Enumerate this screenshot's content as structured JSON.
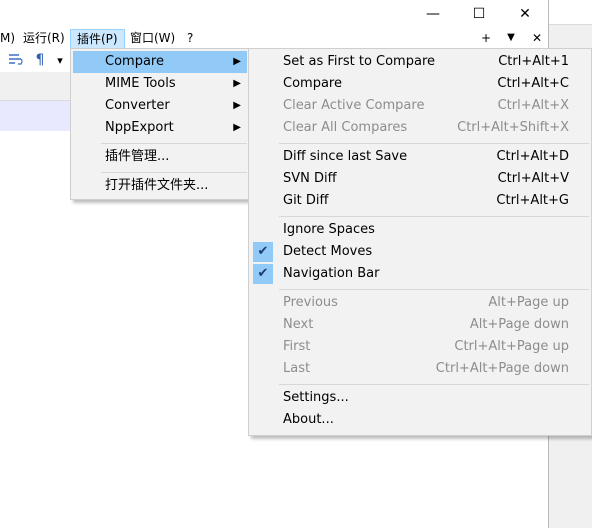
{
  "window": {
    "caption": {
      "minimize": "—",
      "maximize": "☐",
      "close": "✕"
    }
  },
  "menubar": {
    "items": [
      {
        "label": "M)"
      },
      {
        "label": "运行(R)"
      },
      {
        "label": "插件(P)"
      },
      {
        "label": "窗口(W)"
      },
      {
        "label": "?"
      }
    ],
    "doc_controls": {
      "add": "+",
      "dropdown": "▼",
      "close": "✕"
    }
  },
  "toolbar": {
    "icons": [
      "wrap-icon",
      "pilcrow-icon",
      "dropdown-arrow-icon"
    ],
    "pilcrow": "¶",
    "dropdown": "▾"
  },
  "plugins_menu": {
    "items": [
      {
        "label": "Compare",
        "submenu": true
      },
      {
        "label": "MIME Tools",
        "submenu": true
      },
      {
        "label": "Converter",
        "submenu": true
      },
      {
        "label": "NppExport",
        "submenu": true
      },
      {
        "label": "插件管理..."
      },
      {
        "label": "打开插件文件夹..."
      }
    ]
  },
  "compare_menu": {
    "group1": [
      {
        "label": "Set as First to Compare",
        "shortcut": "Ctrl+Alt+1",
        "enabled": true
      },
      {
        "label": "Compare",
        "shortcut": "Ctrl+Alt+C",
        "enabled": true
      },
      {
        "label": "Clear Active Compare",
        "shortcut": "Ctrl+Alt+X",
        "enabled": false
      },
      {
        "label": "Clear All Compares",
        "shortcut": "Ctrl+Alt+Shift+X",
        "enabled": false
      }
    ],
    "group2": [
      {
        "label": "Diff since last Save",
        "shortcut": "Ctrl+Alt+D",
        "enabled": true
      },
      {
        "label": "SVN Diff",
        "shortcut": "Ctrl+Alt+V",
        "enabled": true
      },
      {
        "label": "Git Diff",
        "shortcut": "Ctrl+Alt+G",
        "enabled": true
      }
    ],
    "group3": [
      {
        "label": "Ignore Spaces",
        "checked": false
      },
      {
        "label": "Detect Moves",
        "checked": true
      },
      {
        "label": "Navigation Bar",
        "checked": true
      }
    ],
    "group4": [
      {
        "label": "Previous",
        "shortcut": "Alt+Page up",
        "enabled": false
      },
      {
        "label": "Next",
        "shortcut": "Alt+Page down",
        "enabled": false
      },
      {
        "label": "First",
        "shortcut": "Ctrl+Alt+Page up",
        "enabled": false
      },
      {
        "label": "Last",
        "shortcut": "Ctrl+Alt+Page down",
        "enabled": false
      }
    ],
    "group5": [
      {
        "label": "Settings..."
      },
      {
        "label": "About..."
      }
    ],
    "check_mark": "✔"
  },
  "colors": {
    "highlight": "#91c9f7",
    "menu_bg": "#f2f2f2",
    "disabled_text": "#8d8d8d",
    "current_line": "#e8e8ff"
  }
}
